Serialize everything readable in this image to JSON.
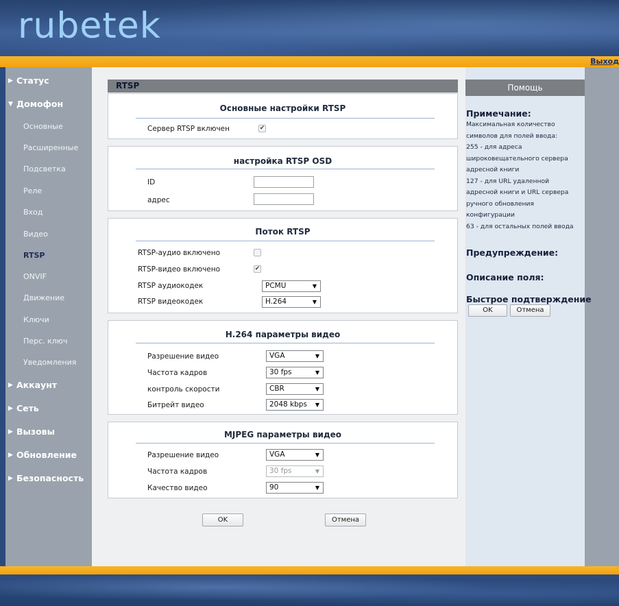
{
  "header": {
    "logo_text": "rubetek",
    "logout": "Выход"
  },
  "sidebar": {
    "status": "Статус",
    "intercom": "Домофон",
    "sub": [
      "Основные",
      "Расширенные",
      "Подсветка",
      "Реле",
      "Вход",
      "Видео",
      "RTSP",
      "ONVIF",
      "Движение",
      "Ключи",
      "Перс. ключ",
      "Уведомления"
    ],
    "active_sub": "RTSP",
    "account": "Аккаунт",
    "network": "Сеть",
    "calls": "Вызовы",
    "update": "Обновление",
    "security": "Безопасность"
  },
  "page": {
    "title": "RTSP"
  },
  "basic": {
    "title": "Основные настройки RTSP",
    "server_label": "Сервер RTSP включен",
    "server_checked": true
  },
  "osd": {
    "title": "настройка RTSP OSD",
    "id_label": "ID",
    "id_value": "",
    "address_label": "адрес",
    "address_value": ""
  },
  "stream": {
    "title": "Поток RTSP",
    "audio_label": "RTSP-аудио включено",
    "audio_checked": false,
    "video_label": "RTSP-видео включено",
    "video_checked": true,
    "audio_codec_label": "RTSP аудиокодек",
    "audio_codec": "PCMU",
    "video_codec_label": "RTSP видеокодек",
    "video_codec": "H.264"
  },
  "h264": {
    "title": "H.264 параметры видео",
    "resolution_label": "Разрешение видео",
    "resolution": "VGA",
    "fps_label": "Частота кадров",
    "fps": "30 fps",
    "rate_label": "контроль скорости",
    "rate": "CBR",
    "bitrate_label": "Битрейт видео",
    "bitrate": "2048 kbps"
  },
  "mjpeg": {
    "title": "MJPEG параметры видео",
    "resolution_label": "Разрешение видео",
    "resolution": "VGA",
    "fps_label": "Частота кадров",
    "fps": "30 fps",
    "quality_label": "Качество видео",
    "quality": "90"
  },
  "actions": {
    "ok": "OK",
    "cancel": "Отмена"
  },
  "help": {
    "head": "Помощь",
    "note_title": "Примечание:",
    "note_lines": [
      "Максимальная количество",
      "символов для полей ввода:",
      "255 - для адреса",
      "широковещательного сервера",
      "адресной книги",
      "127 - для URL удаленной",
      "адресной книги и URL сервера",
      "ручного обновления",
      "конфигурации",
      "63 - для остальных полей ввода"
    ],
    "warning_title": "Предупреждение:",
    "field_desc_title": "Описание поля:",
    "quick_confirm_title": "Быстрое подтверждение",
    "ok": "OK",
    "cancel": "Отмена"
  },
  "colors": {
    "accent_orange": "#f2a20f",
    "sidebar_gray": "#9aa3ad",
    "header_blue": "#2b4a7e"
  }
}
